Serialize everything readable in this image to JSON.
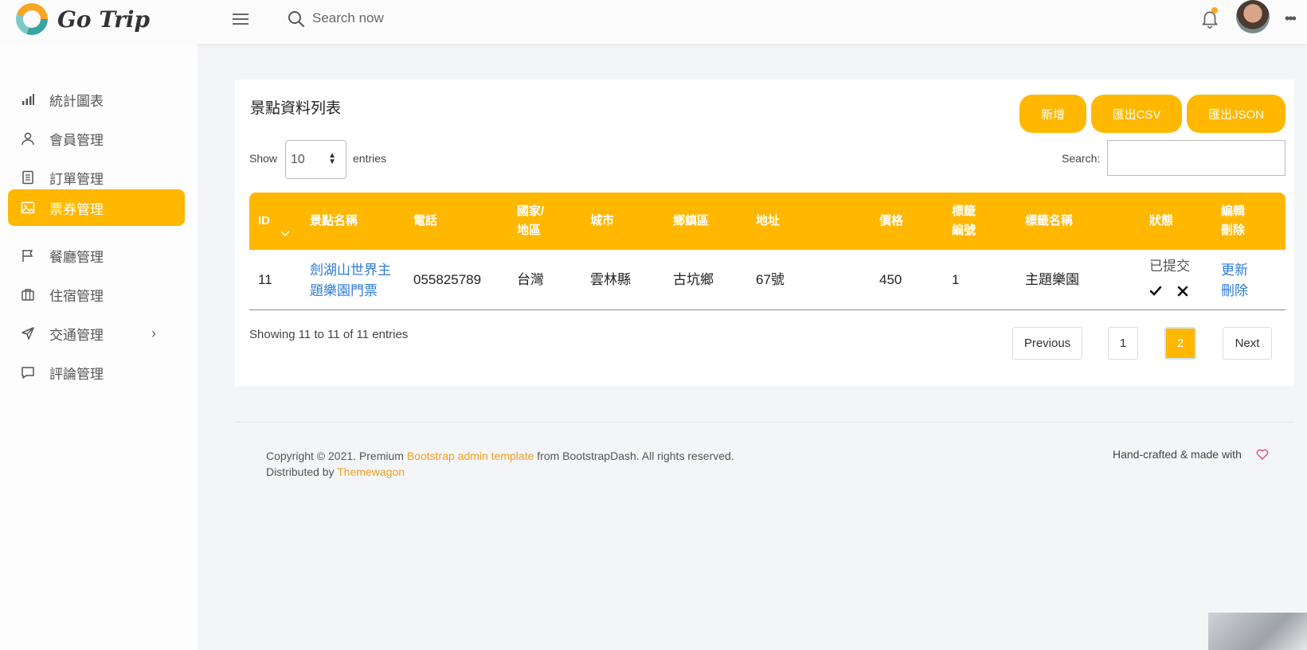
{
  "app": {
    "brand": "Go Trip"
  },
  "header": {
    "search_placeholder": "Search now",
    "more_label": "•••"
  },
  "sidebar": {
    "items": [
      {
        "label": "統計圖表",
        "icon": "bar-chart-icon"
      },
      {
        "label": "會員管理",
        "icon": "user-icon"
      },
      {
        "label": "訂單管理",
        "icon": "document-icon"
      },
      {
        "label": "票券管理",
        "icon": "image-icon",
        "active": true
      },
      {
        "label": "餐廳管理",
        "icon": "flag-icon"
      },
      {
        "label": "住宿管理",
        "icon": "briefcase-icon"
      },
      {
        "label": "交通管理",
        "icon": "send-icon",
        "has_submenu": true,
        "chevron": "›"
      },
      {
        "label": "評論管理",
        "icon": "message-icon"
      }
    ]
  },
  "main": {
    "title": "景點資料列表",
    "buttons": {
      "add": "新增",
      "export_csv": "匯出CSV",
      "export_json": "匯出JSON"
    },
    "show_label": "Show",
    "entries_value": "10",
    "entries_label": "entries",
    "search_label": "Search:",
    "table": {
      "headers": [
        "ID",
        "景點名稱",
        "電話",
        "國家/\n地區",
        "城市",
        "鄉鎮區",
        "地址",
        "價格",
        "標籤\n編號",
        "標籤名稱",
        "狀態",
        "編輯\n刪除"
      ],
      "rows": [
        {
          "id": "11",
          "name": "劍湖山世界主\n題樂園門票",
          "phone": "055825789",
          "country": "台灣",
          "city": "雲林縣",
          "district": "古坑鄉",
          "address": "67號",
          "price": "450",
          "tag_id": "1",
          "tag_name": "主題樂園",
          "status": "已提交",
          "actions": {
            "update": "更新",
            "delete": "刪除"
          }
        }
      ]
    },
    "info": "Showing 11 to 11 of 11 entries",
    "pagination": {
      "previous": "Previous",
      "pages": [
        "1",
        "2"
      ],
      "current": "2",
      "next": "Next"
    }
  },
  "footer": {
    "copyright_prefix": "Copyright © 2021. Premium ",
    "template_link": "Bootstrap admin template",
    "copyright_suffix": " from BootstrapDash. All rights reserved.",
    "distributed_prefix": "Distributed by ",
    "distributed_link": "Themewagon",
    "handcrafted": "Hand-crafted & made with"
  },
  "colors": {
    "accent": "#ffb700",
    "link": "#2e7bd6",
    "footer_link": "#f0a020"
  }
}
